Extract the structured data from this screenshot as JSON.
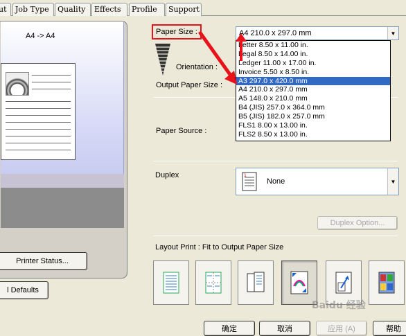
{
  "tabs": [
    "ut",
    "Job Type",
    "Quality",
    "Effects",
    "Profile",
    "Support"
  ],
  "preview": {
    "label": "A4 -> A4"
  },
  "buttons": {
    "printer_status": "Printer Status...",
    "defaults": "l Defaults",
    "duplex_option": "Duplex Option..."
  },
  "settings": {
    "paper_size_label": "Paper Size :",
    "paper_size_value": "A4   210.0 x 297.0 mm",
    "orientation_label": "Orientation :",
    "output_paper_size_label": "Output Paper Size :",
    "paper_source_label": "Paper Source :",
    "duplex_label": "Duplex",
    "duplex_value": "None",
    "layout_print_label": "Layout Print :  Fit to Output Paper Size"
  },
  "dropdown_options": [
    "Letter   8.50 x 11.00 in.",
    "Legal   8.50 x 14.00 in.",
    "Ledger   11.00 x 17.00 in.",
    "Invoice   5.50 x 8.50 in.",
    "A3   297.0 x 420.0 mm",
    "A4   210.0 x 297.0 mm",
    "A5   148.0 x 210.0 mm",
    "B4 (JIS)   257.0 x 364.0 mm",
    "B5 (JIS)   182.0 x 257.0 mm",
    "FLS1   8.00 x 13.00 in.",
    "FLS2   8.50 x 13.00 in."
  ],
  "selected_index": 4,
  "footer": {
    "ok": "确定",
    "cancel": "取消",
    "apply": "应用 (A)",
    "help": "帮助"
  },
  "watermark": "Baidu 经验",
  "colors": {
    "highlight": "#e8121a",
    "selection": "#316ac5"
  }
}
